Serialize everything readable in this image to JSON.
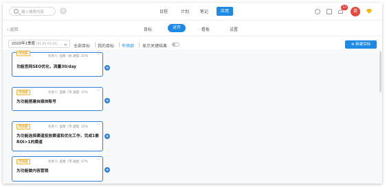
{
  "topbar": {
    "search_placeholder": "输入搜索内容",
    "add_icon": "plus",
    "nav": [
      "日程",
      "计划",
      "笔记",
      "应用"
    ],
    "active_nav": "应用",
    "notification_count": "10",
    "avatar_text": "英"
  },
  "subbar": {
    "back_label": "返回",
    "tabs": [
      "目标",
      "对齐",
      "看板",
      "设置"
    ],
    "active_tab": "对齐"
  },
  "filters": {
    "period": "2020年1季度",
    "period_range": "(01.01-03.31)",
    "tabs": [
      "全部目标",
      "我的目标",
      "市场部"
    ],
    "active_tab": "市场部",
    "toggle_label": "显示关键结果",
    "new_goal_label": "⊕ 新建目标"
  },
  "cards": [
    {
      "tag": "市场部",
      "owner": "负责人: 监察（执...",
      "progress": "进度: 25%",
      "title": "功能官网SEO优化，流量30/day"
    },
    {
      "tag": "市场部",
      "owner": "负责人: 监察（市...",
      "progress": "进度: 37%",
      "title": "为功能搭建自媒体账号"
    },
    {
      "tag": "市场部",
      "owner": "负责人: 监察（市...",
      "progress": "进度: 25%",
      "title": "为功能选择渠道投放渠道和优化工作，完成1套ROI>1的渠道"
    },
    {
      "tag": "市场部",
      "owner": "负责人: 监察（市...",
      "progress": "进度: 47%",
      "title": "为功能做内容营销"
    }
  ],
  "more_label": "···",
  "plus_label": "+"
}
